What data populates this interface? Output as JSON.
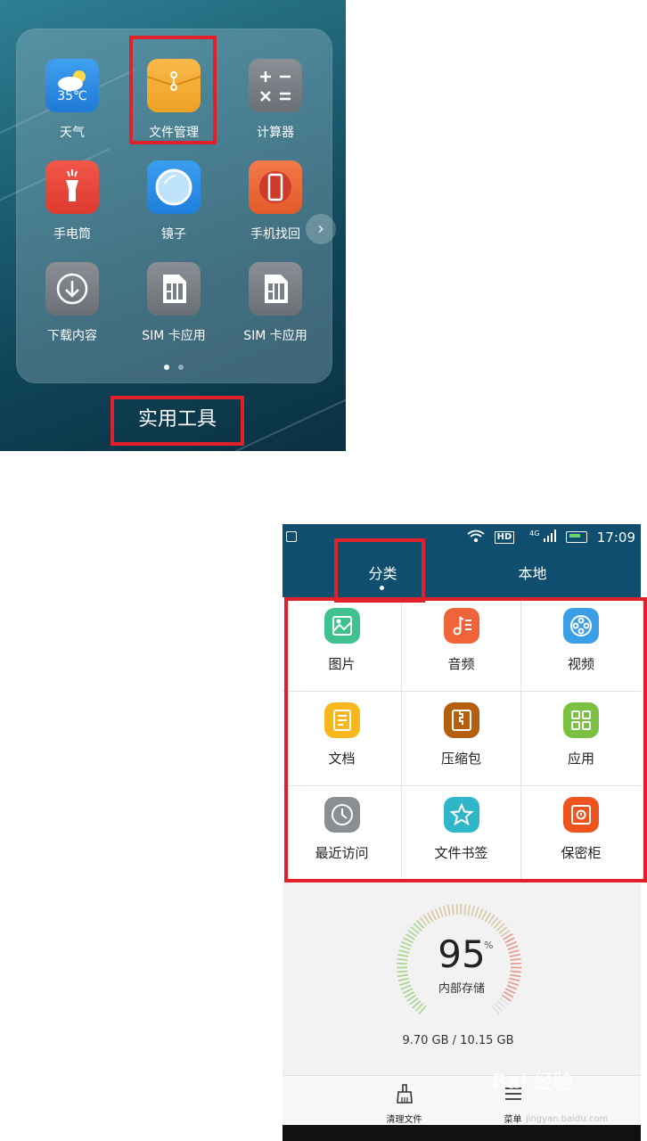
{
  "folder": {
    "title": "实用工具",
    "apps": [
      {
        "label": "天气",
        "icon": "weather-icon",
        "temp": "35℃"
      },
      {
        "label": "文件管理",
        "icon": "file-manager-icon"
      },
      {
        "label": "计算器",
        "icon": "calculator-icon"
      },
      {
        "label": "手电筒",
        "icon": "flashlight-icon"
      },
      {
        "label": "镜子",
        "icon": "mirror-icon"
      },
      {
        "label": "手机找回",
        "icon": "phone-finder-icon"
      },
      {
        "label": "下载内容",
        "icon": "download-icon"
      },
      {
        "label": "SIM 卡应用",
        "icon": "sim-card-icon"
      },
      {
        "label": "SIM 卡应用",
        "icon": "sim-card-icon"
      }
    ],
    "page_count": 2,
    "current_page": 1
  },
  "file_manager": {
    "status": {
      "time": "17:09",
      "network": "4G",
      "hd": "HD"
    },
    "tabs": [
      {
        "label": "分类",
        "active": true
      },
      {
        "label": "本地",
        "active": false
      }
    ],
    "categories": [
      {
        "label": "图片",
        "icon": "image-icon",
        "color": "#3fc28f"
      },
      {
        "label": "音频",
        "icon": "music-icon",
        "color": "#f0643a"
      },
      {
        "label": "视频",
        "icon": "film-reel-icon",
        "color": "#3b9fe8"
      },
      {
        "label": "文档",
        "icon": "document-icon",
        "color": "#f6b81d"
      },
      {
        "label": "压缩包",
        "icon": "archive-icon",
        "color": "#b55e0f"
      },
      {
        "label": "应用",
        "icon": "apps-grid-icon",
        "color": "#7ac142"
      },
      {
        "label": "最近访问",
        "icon": "clock-icon",
        "color": "#8b8f94"
      },
      {
        "label": "文件书签",
        "icon": "star-icon",
        "color": "#2fb7c9"
      },
      {
        "label": "保密柜",
        "icon": "safe-icon",
        "color": "#f0541e"
      }
    ],
    "storage": {
      "percent": "95",
      "percent_symbol": "%",
      "used_fraction": 0.95,
      "label": "内部存储",
      "amount": "9.70 GB / 10.15 GB"
    },
    "bottom": [
      {
        "label": "清理文件",
        "icon": "broom-icon"
      },
      {
        "label": "菜单",
        "icon": "menu-icon"
      }
    ]
  },
  "watermark": {
    "text": "Bai 经验",
    "sub": "jingyan.baidu.com"
  },
  "colors": {
    "highlight_red": "#e0202a",
    "header_blue": "#0f4e6f"
  }
}
